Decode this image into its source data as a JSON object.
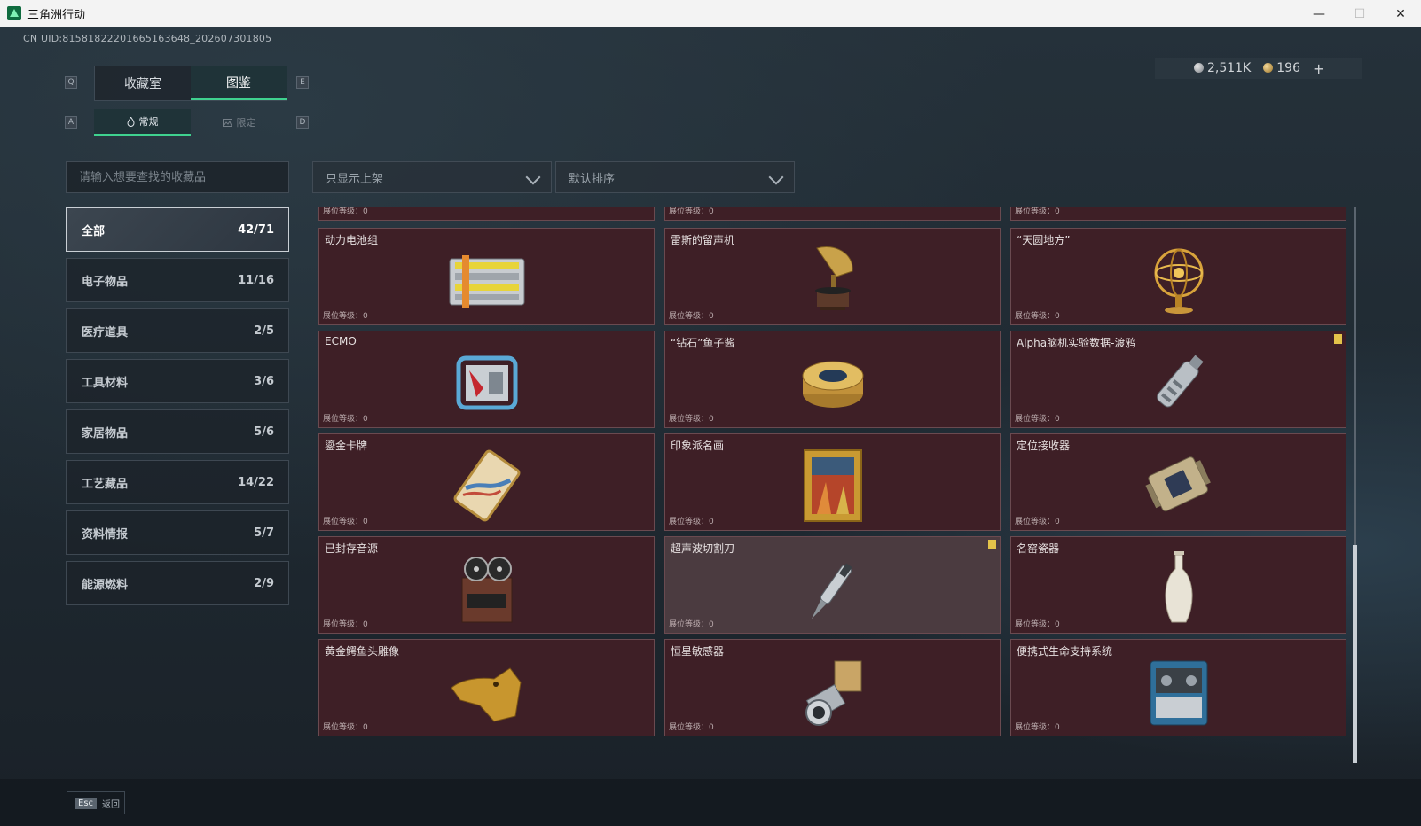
{
  "window": {
    "title": "三角洲行动",
    "minimize": "—",
    "maximize": "☐",
    "close": "✕"
  },
  "uid": "CN UID:815818222016651636​48_202607301805",
  "currency": {
    "silver": "2,511K",
    "gold": "196",
    "add": "+"
  },
  "keys": {
    "prev_tab": "Q",
    "next_tab": "E",
    "prev_sub": "A",
    "next_sub": "D"
  },
  "tabs": [
    {
      "label": "收藏室",
      "active": false
    },
    {
      "label": "图鉴",
      "active": true
    }
  ],
  "subtabs": [
    {
      "label": "常规",
      "icon": "flame-icon",
      "active": true
    },
    {
      "label": "限定",
      "icon": "image-icon",
      "active": false
    }
  ],
  "search": {
    "placeholder": "请输入想要查找的收藏品"
  },
  "filters": {
    "shelf": {
      "value": "只显示上架"
    },
    "sort": {
      "value": "默认排序"
    }
  },
  "categories": [
    {
      "label": "全部",
      "count": "42/71",
      "active": true
    },
    {
      "label": "电子物品",
      "count": "11/16"
    },
    {
      "label": "医疗道具",
      "count": "2/5"
    },
    {
      "label": "工具材料",
      "count": "3/6"
    },
    {
      "label": "家居物品",
      "count": "5/6"
    },
    {
      "label": "工艺藏品",
      "count": "14/22"
    },
    {
      "label": "资料情报",
      "count": "5/7"
    },
    {
      "label": "能源燃料",
      "count": "2/9"
    }
  ],
  "level_label": "展位等级：0",
  "items": [
    {
      "name": "",
      "level": "展位等级：0",
      "art": "partial"
    },
    {
      "name": "",
      "level": "展位等级：0",
      "art": "partial"
    },
    {
      "name": "",
      "level": "展位等级：0",
      "art": "partial"
    },
    {
      "name": "动力电池组",
      "level": "展位等级：0",
      "art": "battery-icon"
    },
    {
      "name": "雷斯的留声机",
      "level": "展位等级：0",
      "art": "gramophone-icon"
    },
    {
      "name": "“天圆地方”",
      "level": "展位等级：0",
      "art": "armillary-icon"
    },
    {
      "name": "ECMO",
      "level": "展位等级：0",
      "art": "ecmo-icon"
    },
    {
      "name": "“钻石”鱼子酱",
      "level": "展位等级：0",
      "art": "caviar-icon"
    },
    {
      "name": "Alpha脑机实验数据-渡鸦",
      "level": "展位等级：0",
      "art": "datadrive-icon",
      "flag": true
    },
    {
      "name": "鎏金卡牌",
      "level": "展位等级：0",
      "art": "card-icon"
    },
    {
      "name": "印象派名画",
      "level": "展位等级：0",
      "art": "painting-icon"
    },
    {
      "name": "定位接收器",
      "level": "展位等级：0",
      "art": "receiver-icon"
    },
    {
      "name": "已封存音源",
      "level": "展位等级：0",
      "art": "reel-icon"
    },
    {
      "name": "超声波切割刀",
      "level": "展位等级：0",
      "art": "cutter-icon",
      "flag": true,
      "highlight": true
    },
    {
      "name": "名窑瓷器",
      "level": "展位等级：0",
      "art": "vase-icon"
    },
    {
      "name": "黄金鳄鱼头雕像",
      "level": "展位等级：0",
      "art": "croc-icon"
    },
    {
      "name": "恒星敏感器",
      "level": "展位等级：0",
      "art": "sensor-icon"
    },
    {
      "name": "便携式生命支持系统",
      "level": "展位等级：0",
      "art": "lifesupport-icon"
    }
  ],
  "bottom": {
    "esc_key": "Esc",
    "esc_label": "返回"
  }
}
